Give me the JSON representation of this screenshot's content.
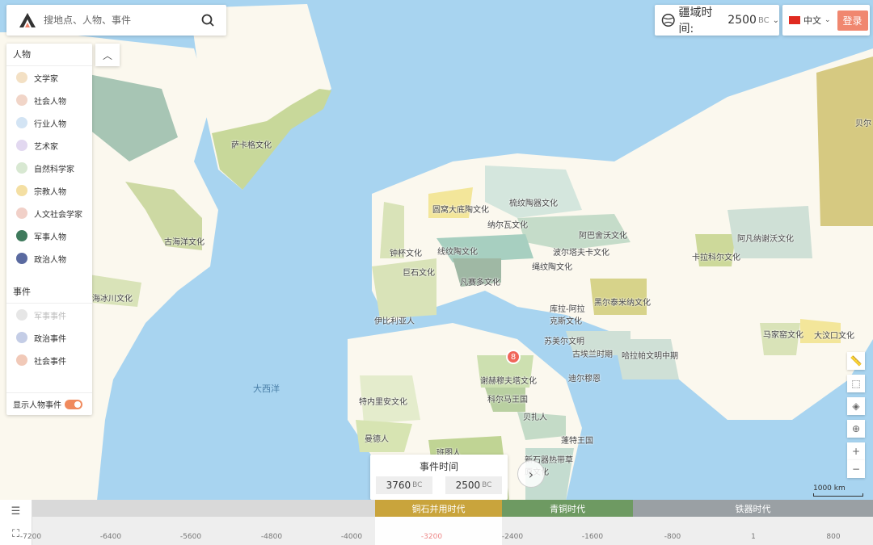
{
  "search": {
    "placeholder": "搜地点、人物、事件"
  },
  "era": {
    "label": "疆域时间:",
    "year": "2500",
    "unit": "BC"
  },
  "lang": {
    "label": "中文",
    "login": "登录"
  },
  "panel": {
    "people_title": "人物",
    "people": [
      "文学家",
      "社会人物",
      "行业人物",
      "艺术家",
      "自然科学家",
      "宗教人物",
      "人文社会学家",
      "军事人物",
      "政治人物"
    ],
    "events_title": "事件",
    "events": [
      "军事事件",
      "政治事件",
      "社会事件"
    ],
    "toggle_label": "显示人物事件"
  },
  "map": {
    "ocean": "大西洋",
    "labels": [
      "萨卡格文化",
      "古海洋文化",
      "海冰川文化",
      "圆窝大底陶文化",
      "梳纹陶器文化",
      "纳尔瓦文化",
      "阿巴舍沃文化",
      "钟杯文化",
      "线纹陶文化",
      "波尔塔夫卡文化",
      "巨石文化",
      "绳纹陶文化",
      "凡赛多文化",
      "伊比利亚人",
      "库拉-阿拉克斯文化",
      "黑尔泰米纳文化",
      "苏美尔文明",
      "古埃兰时期",
      "哈拉帕文明中期",
      "迪尔穆恩",
      "谢赫穆夫塔文化",
      "科尔马王国",
      "特内里安文化",
      "贝扎人",
      "曼德人",
      "蓬特王国",
      "新石器热带草原文化",
      "班图人",
      "卡拉科尔文化",
      "阿凡纳谢沃文化",
      "马家窑文化",
      "大汶口文化",
      "贝尔"
    ],
    "marker_count": "8",
    "scale": "1000 km"
  },
  "event_time": {
    "title": "事件时间",
    "start": "3760",
    "end": "2500",
    "unit": "BC"
  },
  "timeline": {
    "eras": [
      "铜石并用时代",
      "青铜时代",
      "铁器时代"
    ],
    "ticks": [
      "-7200",
      "-6400",
      "-5600",
      "-4800",
      "-4000",
      "-3200",
      "-2400",
      "-1600",
      "-800",
      "1",
      "800"
    ]
  },
  "colors": {
    "accent": "#f0876f",
    "copper": "#c9a43c",
    "bronze": "#6e9a62",
    "iron": "#9aa0a4"
  }
}
